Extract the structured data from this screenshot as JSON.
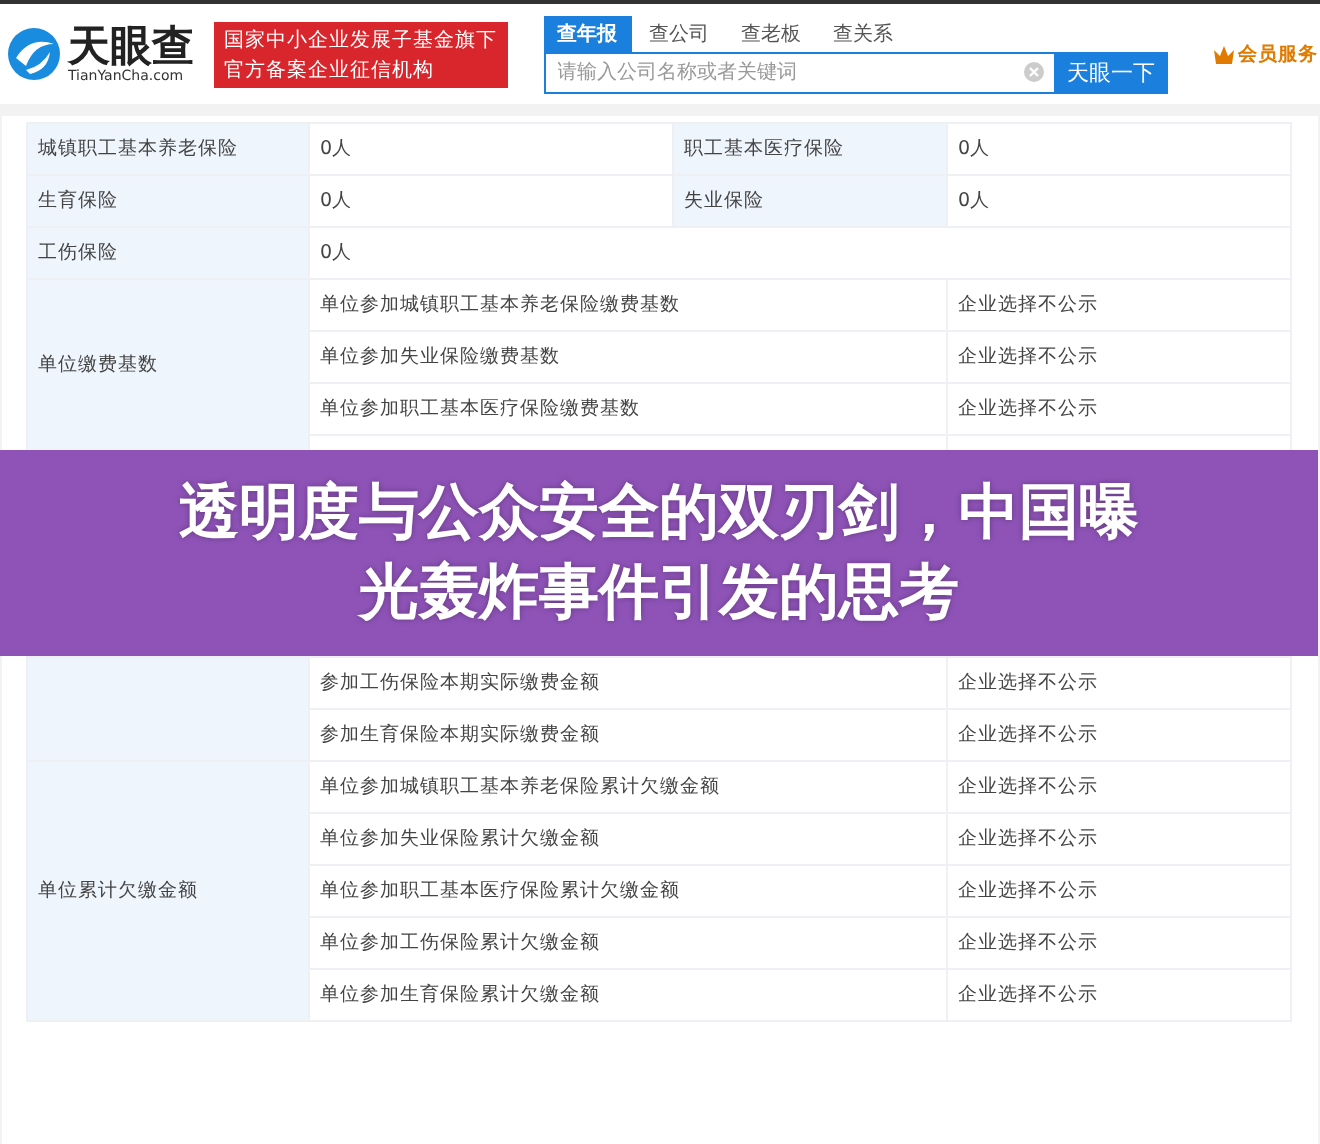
{
  "header": {
    "logo_name": "天眼查",
    "logo_domain": "TianYanCha.com",
    "badge_lines": [
      "国家中小企业发展子基金旗下",
      "官方备案企业征信机构"
    ],
    "search_tabs": [
      {
        "label": "查年报",
        "selected": true
      },
      {
        "label": "查公司",
        "selected": false
      },
      {
        "label": "查老板",
        "selected": false
      },
      {
        "label": "查关系",
        "selected": false
      }
    ],
    "search": {
      "placeholder": "请输入公司名称或者关键词",
      "button": "天眼一下"
    },
    "member": "会员服务"
  },
  "top_rows": [
    {
      "cells": [
        {
          "label": "城镇职工基本养老保险",
          "value": "0人"
        },
        {
          "label": "职工基本医疗保险",
          "value": "0人"
        }
      ]
    },
    {
      "cells": [
        {
          "label": "生育保险",
          "value": "0人"
        },
        {
          "label": "失业保险",
          "value": "0人"
        }
      ]
    },
    {
      "cells": [
        {
          "label": "工伤保险",
          "value": "0人"
        }
      ]
    }
  ],
  "groups_before": [
    {
      "label": "单位缴费基数",
      "rows": [
        {
          "item": "单位参加城镇职工基本养老保险缴费基数",
          "value": "企业选择不公示"
        },
        {
          "item": "单位参加失业保险缴费基数",
          "value": "企业选择不公示"
        },
        {
          "item": "单位参加职工基本医疗保险缴费基数",
          "value": "企业选择不公示"
        }
      ]
    }
  ],
  "banner": {
    "title_lines": [
      "透明度与公众安全的双刃剑，中国曝",
      "光轰炸事件引发的思考"
    ]
  },
  "groups_after": [
    {
      "rows": [
        {
          "item": "参加工伤保险本期实际缴费金额",
          "value": "企业选择不公示"
        },
        {
          "item": "参加生育保险本期实际缴费金额",
          "value": "企业选择不公示"
        }
      ]
    },
    {
      "label": "单位累计欠缴金额",
      "rows": [
        {
          "item": "单位参加城镇职工基本养老保险累计欠缴金额",
          "value": "企业选择不公示"
        },
        {
          "item": "单位参加失业保险累计欠缴金额",
          "value": "企业选择不公示"
        },
        {
          "item": "单位参加职工基本医疗保险累计欠缴金额",
          "value": "企业选择不公示"
        },
        {
          "item": "单位参加工伤保险累计欠缴金额",
          "value": "企业选择不公示"
        },
        {
          "item": "单位参加生育保险累计欠缴金额",
          "value": "企业选择不公示"
        }
      ]
    }
  ]
}
